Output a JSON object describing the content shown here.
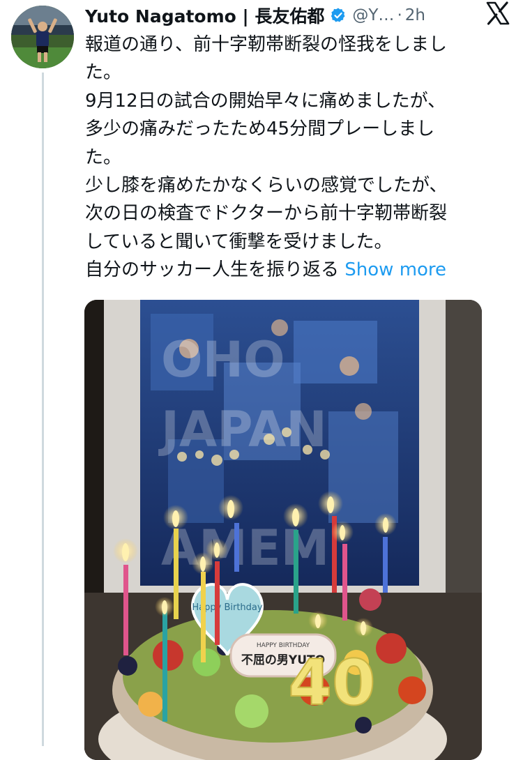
{
  "tweet": {
    "author": {
      "display_name": "Yuto Nagatomo | 長友佑都",
      "handle": "@Y…",
      "separator": "·",
      "time": "2h"
    },
    "icons": {
      "verified": "verified-badge-icon",
      "brand": "x-logo-icon"
    },
    "body_lines": [
      "報道の通り、前十字靭帯断裂の怪我をしまし",
      "た。",
      "9月12日の試合の開始早々に痛めましたが、",
      "多少の痛みだったため45分間プレーしまし",
      "た。",
      "少し膝を痛めたかなくらいの感覚でしたが、",
      "次の日の検査でドクターから前十字靭帯断裂",
      "していると聞いて衝撃を受けました。"
    ],
    "truncated_line": "自分のサッカー人生を振り返る",
    "show_more": "Show more",
    "media": {
      "cake_sign": "不屈の男YUTO",
      "cake_sign_top": "HAPPY BIRTHDAY",
      "heart_text": "Happy Birthday",
      "candle_number": "40"
    },
    "colors": {
      "link": "#1d9bf0",
      "verified": "#1d9bf0",
      "secondary_text": "#536471",
      "thread_line": "#cfd9de"
    }
  }
}
